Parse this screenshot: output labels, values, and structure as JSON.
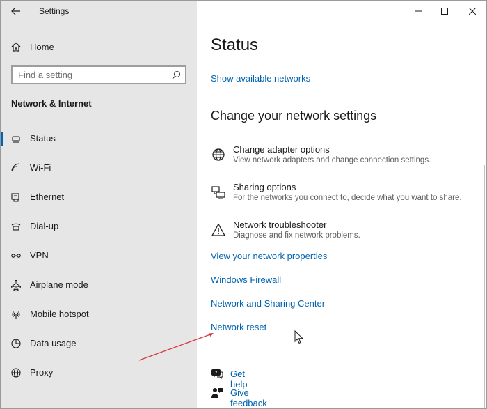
{
  "window": {
    "title": "Settings"
  },
  "sidebar": {
    "home_label": "Home",
    "search_placeholder": "Find a setting",
    "section_title": "Network & Internet",
    "items": [
      {
        "label": "Status",
        "icon": "status-icon",
        "selected": true
      },
      {
        "label": "Wi-Fi",
        "icon": "wifi-icon",
        "selected": false
      },
      {
        "label": "Ethernet",
        "icon": "ethernet-icon",
        "selected": false
      },
      {
        "label": "Dial-up",
        "icon": "dialup-icon",
        "selected": false
      },
      {
        "label": "VPN",
        "icon": "vpn-icon",
        "selected": false
      },
      {
        "label": "Airplane mode",
        "icon": "airplane-icon",
        "selected": false
      },
      {
        "label": "Mobile hotspot",
        "icon": "hotspot-icon",
        "selected": false
      },
      {
        "label": "Data usage",
        "icon": "data-usage-icon",
        "selected": false
      },
      {
        "label": "Proxy",
        "icon": "proxy-icon",
        "selected": false
      }
    ]
  },
  "main": {
    "title": "Status",
    "show_networks_link": "Show available networks",
    "change_heading": "Change your network settings",
    "options": [
      {
        "title": "Change adapter options",
        "desc": "View network adapters and change connection settings.",
        "icon": "adapter-icon"
      },
      {
        "title": "Sharing options",
        "desc": "For the networks you connect to, decide what you want to share.",
        "icon": "sharing-icon"
      },
      {
        "title": "Network troubleshooter",
        "desc": "Diagnose and fix network problems.",
        "icon": "warning-icon"
      }
    ],
    "links": {
      "view_properties": "View your network properties",
      "firewall": "Windows Firewall",
      "sharing_center": "Network and Sharing Center",
      "network_reset": "Network reset"
    },
    "help": {
      "get_help": "Get help",
      "give_feedback": "Give feedback"
    }
  },
  "colors": {
    "accent": "#0063b1",
    "sidebar_bg": "#e6e6e6",
    "annotation_arrow": "#d9363e"
  }
}
